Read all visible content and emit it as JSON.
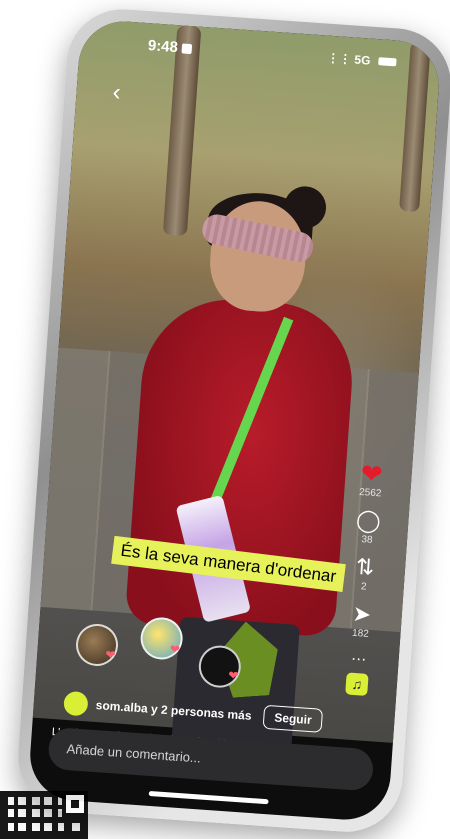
{
  "status_bar": {
    "time": "9:48",
    "network": "5G"
  },
  "video": {
    "caption": "És la seva manera d'ordenar"
  },
  "actions": {
    "likes": "2562",
    "comments": "38",
    "reposts": "2",
    "shares": "182"
  },
  "author": {
    "username": "som.alba y 2 personas más",
    "follow_label": "Seguir"
  },
  "description": "L'autisme està envoltat de moltes idees ...",
  "comment_input": {
    "placeholder": "Añade un comentario..."
  },
  "colors": {
    "like": "#e51b2b",
    "caption_bg": "#e7f25a",
    "accent": "#d8ef36"
  }
}
